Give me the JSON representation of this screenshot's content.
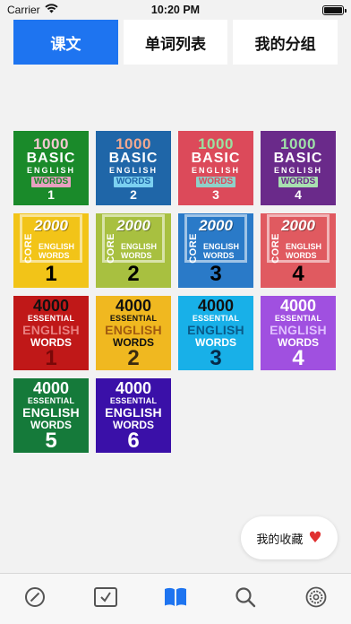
{
  "status_bar": {
    "carrier": "Carrier",
    "time": "10:20 PM"
  },
  "tabs": [
    {
      "label": "课文",
      "active": true
    },
    {
      "label": "单词列表",
      "active": false
    },
    {
      "label": "我的分组",
      "active": false
    }
  ],
  "books_1000": [
    {
      "line1": "1000",
      "line2": "BASIC",
      "line3": "ENGLISH",
      "line4": "WORDS",
      "num": "1",
      "bg": "#1a8a2a",
      "accent": "#f2c7d0",
      "wordsBg": "#e8a0c0",
      "wordsColor": "#1a8a2a"
    },
    {
      "line1": "1000",
      "line2": "BASIC",
      "line3": "ENGLISH",
      "line4": "WORDS",
      "num": "2",
      "bg": "#1f66a8",
      "accent": "#f0a890",
      "wordsBg": "#7bd0f0",
      "wordsColor": "#1f66a8"
    },
    {
      "line1": "1000",
      "line2": "BASIC",
      "line3": "ENGLISH",
      "line4": "WORDS",
      "num": "3",
      "bg": "#dc4a5a",
      "accent": "#9be0a0",
      "wordsBg": "#8fd0c8",
      "wordsColor": "#dc4a5a"
    },
    {
      "line1": "1000",
      "line2": "BASIC",
      "line3": "ENGLISH",
      "line4": "WORDS",
      "num": "4",
      "bg": "#6a2a8a",
      "accent": "#9fe0a8",
      "wordsBg": "#a8e0b0",
      "wordsColor": "#6a2a8a"
    }
  ],
  "books_2000": [
    {
      "line1": "2000",
      "core": "CORE",
      "line3": "ENGLISH",
      "line4": "WORDS",
      "num": "1",
      "bg": "#f2c418"
    },
    {
      "line1": "2000",
      "core": "CORE",
      "line3": "ENGLISH",
      "line4": "WORDS",
      "num": "2",
      "bg": "#a8c040"
    },
    {
      "line1": "2000",
      "core": "CORE",
      "line3": "ENGLISH",
      "line4": "WORDS",
      "num": "3",
      "bg": "#2a7ac8"
    },
    {
      "line1": "2000",
      "core": "CORE",
      "line3": "ENGLISH",
      "line4": "WORDS",
      "num": "4",
      "bg": "#e05a60"
    }
  ],
  "books_4000": [
    {
      "line1": "4000",
      "line2": "ESSENTIAL",
      "line3": "ENGLISH",
      "line4": "WORDS",
      "num": "1",
      "bg": "#c01818",
      "c1": "#111111",
      "c2": "#ffffff",
      "c3": "#e88080",
      "c4": "#ffffff",
      "cnum": "#7a0808"
    },
    {
      "line1": "4000",
      "line2": "ESSENTIAL",
      "line3": "ENGLISH",
      "line4": "WORDS",
      "num": "2",
      "bg": "#f0b820",
      "c1": "#111111",
      "c2": "#111111",
      "c3": "#a05a10",
      "c4": "#111111",
      "cnum": "#3a2a10"
    },
    {
      "line1": "4000",
      "line2": "ESSENTIAL",
      "line3": "ENGLISH",
      "line4": "WORDS",
      "num": "3",
      "bg": "#18b0e8",
      "c1": "#111111",
      "c2": "#ffffff",
      "c3": "#0a5a88",
      "c4": "#ffffff",
      "cnum": "#062a48"
    },
    {
      "line1": "4000",
      "line2": "ESSENTIAL",
      "line3": "ENGLISH",
      "line4": "WORDS",
      "num": "4",
      "bg": "#a050e0",
      "c1": "#ffffff",
      "c2": "#ffffff",
      "c3": "#e0c0ff",
      "c4": "#ffffff",
      "cnum": "#ffffff"
    },
    {
      "line1": "4000",
      "line2": "ESSENTIAL",
      "line3": "ENGLISH",
      "line4": "WORDS",
      "num": "5",
      "bg": "#157a3a",
      "c1": "#ffffff",
      "c2": "#ffffff",
      "c3": "#ffffff",
      "c4": "#ffffff",
      "cnum": "#ffffff"
    },
    {
      "line1": "4000",
      "line2": "ESSENTIAL",
      "line3": "ENGLISH",
      "line4": "WORDS",
      "num": "6",
      "bg": "#3a10a8",
      "c1": "#ffffff",
      "c2": "#ffffff",
      "c3": "#ffffff",
      "c4": "#ffffff",
      "cnum": "#ffffff"
    }
  ],
  "favorites": {
    "label": "我的收藏",
    "icon": "heart-icon"
  },
  "tabbar": {
    "items": [
      {
        "icon": "compass-icon",
        "active": false
      },
      {
        "icon": "checkbox-icon",
        "active": false
      },
      {
        "icon": "book-icon",
        "active": true
      },
      {
        "icon": "search-icon",
        "active": false
      },
      {
        "icon": "settings-icon",
        "active": false
      }
    ],
    "active_color": "#1e74f0",
    "inactive_color": "#555555"
  }
}
